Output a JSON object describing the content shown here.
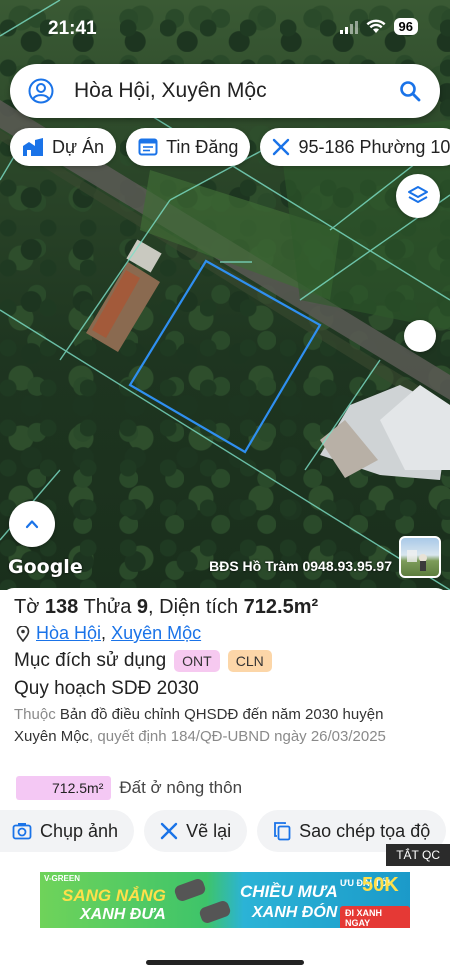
{
  "status_bar": {
    "time": "21:41",
    "battery": "96"
  },
  "search": {
    "query": "Hòa Hội, Xuyên Mộc",
    "user_icon": "user-circle-icon",
    "search_icon": "search-icon"
  },
  "chips": [
    {
      "label": "Dự Án",
      "icon": "building-icon"
    },
    {
      "label": "Tin Đăng",
      "icon": "listing-icon"
    },
    {
      "label": "95-186 Phường 10",
      "icon": "ruler-icon"
    }
  ],
  "map": {
    "google": "Google",
    "watermark": "BĐS Hồ Tràm 0948.93.95.97",
    "boundary_color": "#2f8ff0"
  },
  "parcel": {
    "prefix_to": "Tờ",
    "to": "138",
    "prefix_thua": "Thửa",
    "thua": "9",
    "sep": ",",
    "prefix_dt": "Diện tích",
    "area": "712.5m²",
    "ward": "Hòa Hội",
    "district": "Xuyên Mộc",
    "comma": ",",
    "purpose_label": "Mục đích sử dụng",
    "tags": [
      "ONT",
      "CLN"
    ],
    "plan_title": "Quy hoạch SDĐ 2030",
    "desc_prefix": "Thuộc",
    "desc_main": "Bản đồ điều chỉnh QHSDĐ đến năm 2030 huyện Xuyên Mộc",
    "desc_suffix": ", quyết định 184/QĐ-UBND ngày 26/03/2025",
    "legend_area": "712.5m²",
    "legend_label": "Đất ở nông thôn"
  },
  "actions": [
    {
      "label": "Chụp ảnh",
      "icon": "camera-icon"
    },
    {
      "label": "Vẽ lại",
      "icon": "ruler-icon"
    },
    {
      "label": "Sao chép tọa độ",
      "icon": "copy-icon"
    }
  ],
  "ad_close": "TẮT QC",
  "ad": {
    "brand": "V-GREEN",
    "left_line1": "SANG NẮNG",
    "left_line2": "XANH ĐƯA",
    "right_line1": "CHIỀU MƯA",
    "right_line2": "XANH ĐÓN",
    "promo_top": "ƯU ĐÃI TỚI",
    "promo_value": "50K",
    "promo_cta": "ĐI XANH NGAY"
  }
}
